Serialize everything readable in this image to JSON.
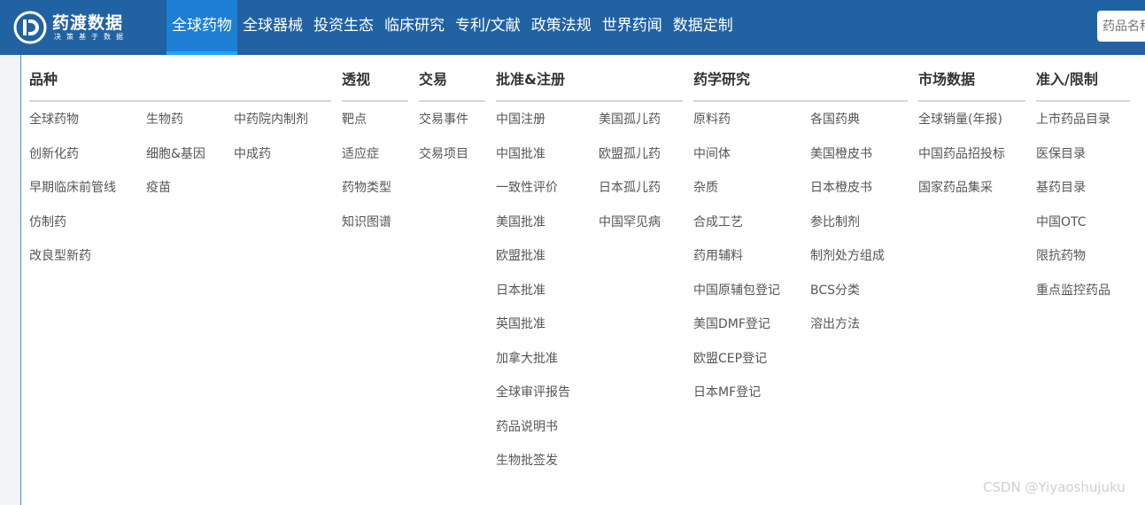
{
  "brand": {
    "title": "药渡数据",
    "slogan": "决策基于数据"
  },
  "nav": [
    "全球药物",
    "全球器械",
    "投资生态",
    "临床研究",
    "专利/文献",
    "政策法规",
    "世界药闻",
    "数据定制"
  ],
  "search": {
    "placeholder": "药品名称"
  },
  "menu": {
    "categories": {
      "title": "品种",
      "col1": [
        "全球药物",
        "创新化药",
        "早期临床前管线",
        "仿制药",
        "改良型新药"
      ],
      "col2": [
        "生物药",
        "细胞&基因",
        "疫苗"
      ],
      "col3": [
        "中药院内制剂",
        "中成药"
      ]
    },
    "perspective": {
      "title": "透视",
      "items": [
        "靶点",
        "适应症",
        "药物类型",
        "知识图谱"
      ]
    },
    "trade": {
      "title": "交易",
      "items": [
        "交易事件",
        "交易项目"
      ]
    },
    "approval": {
      "title": "批准&注册",
      "col1": [
        "中国注册",
        "中国批准",
        "一致性评价",
        "美国批准",
        "欧盟批准",
        "日本批准",
        "英国批准",
        "加拿大批准",
        "全球审评报告",
        "药品说明书",
        "生物批签发"
      ],
      "col2": [
        "美国孤儿药",
        "欧盟孤儿药",
        "日本孤儿药",
        "中国罕见病"
      ]
    },
    "pharma": {
      "title": "药学研究",
      "col1": [
        "原料药",
        "中间体",
        "杂质",
        "合成工艺",
        "药用辅料",
        "中国原辅包登记",
        "美国DMF登记",
        "欧盟CEP登记",
        "日本MF登记"
      ],
      "col2": [
        "各国药典",
        "美国橙皮书",
        "日本橙皮书",
        "参比制剂",
        "制剂处方组成",
        "BCS分类",
        "溶出方法"
      ]
    },
    "market": {
      "title": "市场数据",
      "items": [
        "全球销量(年报)",
        "中国药品招投标",
        "国家药品集采"
      ]
    },
    "access": {
      "title": "准入/限制",
      "items": [
        "上市药品目录",
        "医保目录",
        "基药目录",
        "中国OTC",
        "限抗药物",
        "重点监控药品"
      ]
    }
  },
  "watermark": "CSDN @Yiyaoshujuku"
}
